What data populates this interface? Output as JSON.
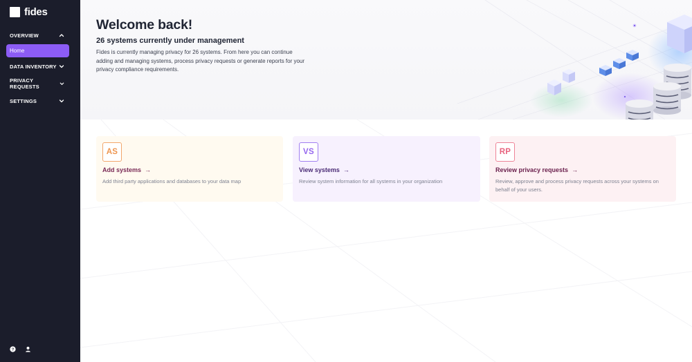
{
  "brand": {
    "name": "fides"
  },
  "sidebar": {
    "groups": [
      {
        "label": "OVERVIEW",
        "expanded": true,
        "items": [
          {
            "label": "Home",
            "active": true
          }
        ]
      },
      {
        "label": "DATA INVENTORY",
        "expanded": false
      },
      {
        "label": "PRIVACY REQUESTS",
        "expanded": false
      },
      {
        "label": "SETTINGS",
        "expanded": false
      }
    ],
    "footer_icons": [
      "help-icon",
      "user-icon"
    ]
  },
  "hero": {
    "title": "Welcome back!",
    "subtitle": "26 systems currently under management",
    "description": "Fides is currently managing privacy for 26 systems. From here you can continue adding and managing systems, process privacy requests or generate reports for your privacy compliance requirements."
  },
  "cards": [
    {
      "badge": "AS",
      "title": "Add systems",
      "description": "Add third party applications and databases to your data map",
      "accent": "#ee9650"
    },
    {
      "badge": "VS",
      "title": "View systems",
      "description": "Review system information for all systems in your organization",
      "accent": "#9567ee"
    },
    {
      "badge": "RP",
      "title": "Review privacy requests",
      "description": "Review, approve and process privacy requests across your systems on behalf of your users.",
      "accent": "#e8637e"
    }
  ],
  "colors": {
    "sidebar_bg": "#1b1d2b",
    "active_item": "#8c5cf5"
  }
}
